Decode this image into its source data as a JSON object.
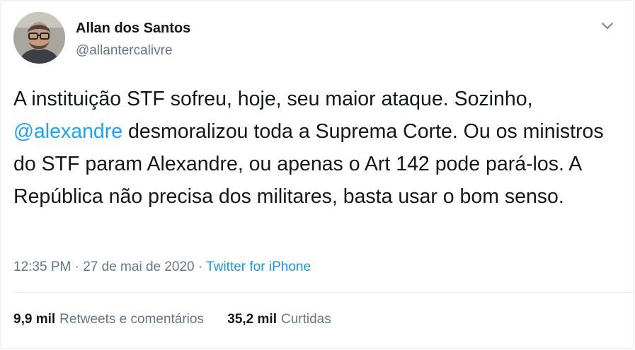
{
  "author": {
    "name": "Allan dos Santos",
    "handle": "@allantercalivre"
  },
  "tweet": {
    "text_before": "A instituição STF sofreu, hoje, seu maior ataque. Sozinho, ",
    "mention": "@alexandre",
    "text_after": " desmoralizou toda a Suprema Corte. Ou os ministros do STF param Alexandre, ou apenas o Art 142 pode pará-los. A República não precisa dos militares, basta usar o bom senso."
  },
  "meta": {
    "time": "12:35 PM",
    "sep1": "·",
    "date": "27 de mai de 2020",
    "sep2": "·",
    "source": "Twitter for iPhone"
  },
  "stats": {
    "retweets_count": "9,9 mil",
    "retweets_label": "Retweets e comentários",
    "likes_count": "35,2 mil",
    "likes_label": "Curtidas"
  },
  "icons": {
    "caret": "chevron-down-icon"
  },
  "colors": {
    "link": "#1da1f2",
    "secondary": "#657786",
    "divider": "#e6ecf0"
  }
}
